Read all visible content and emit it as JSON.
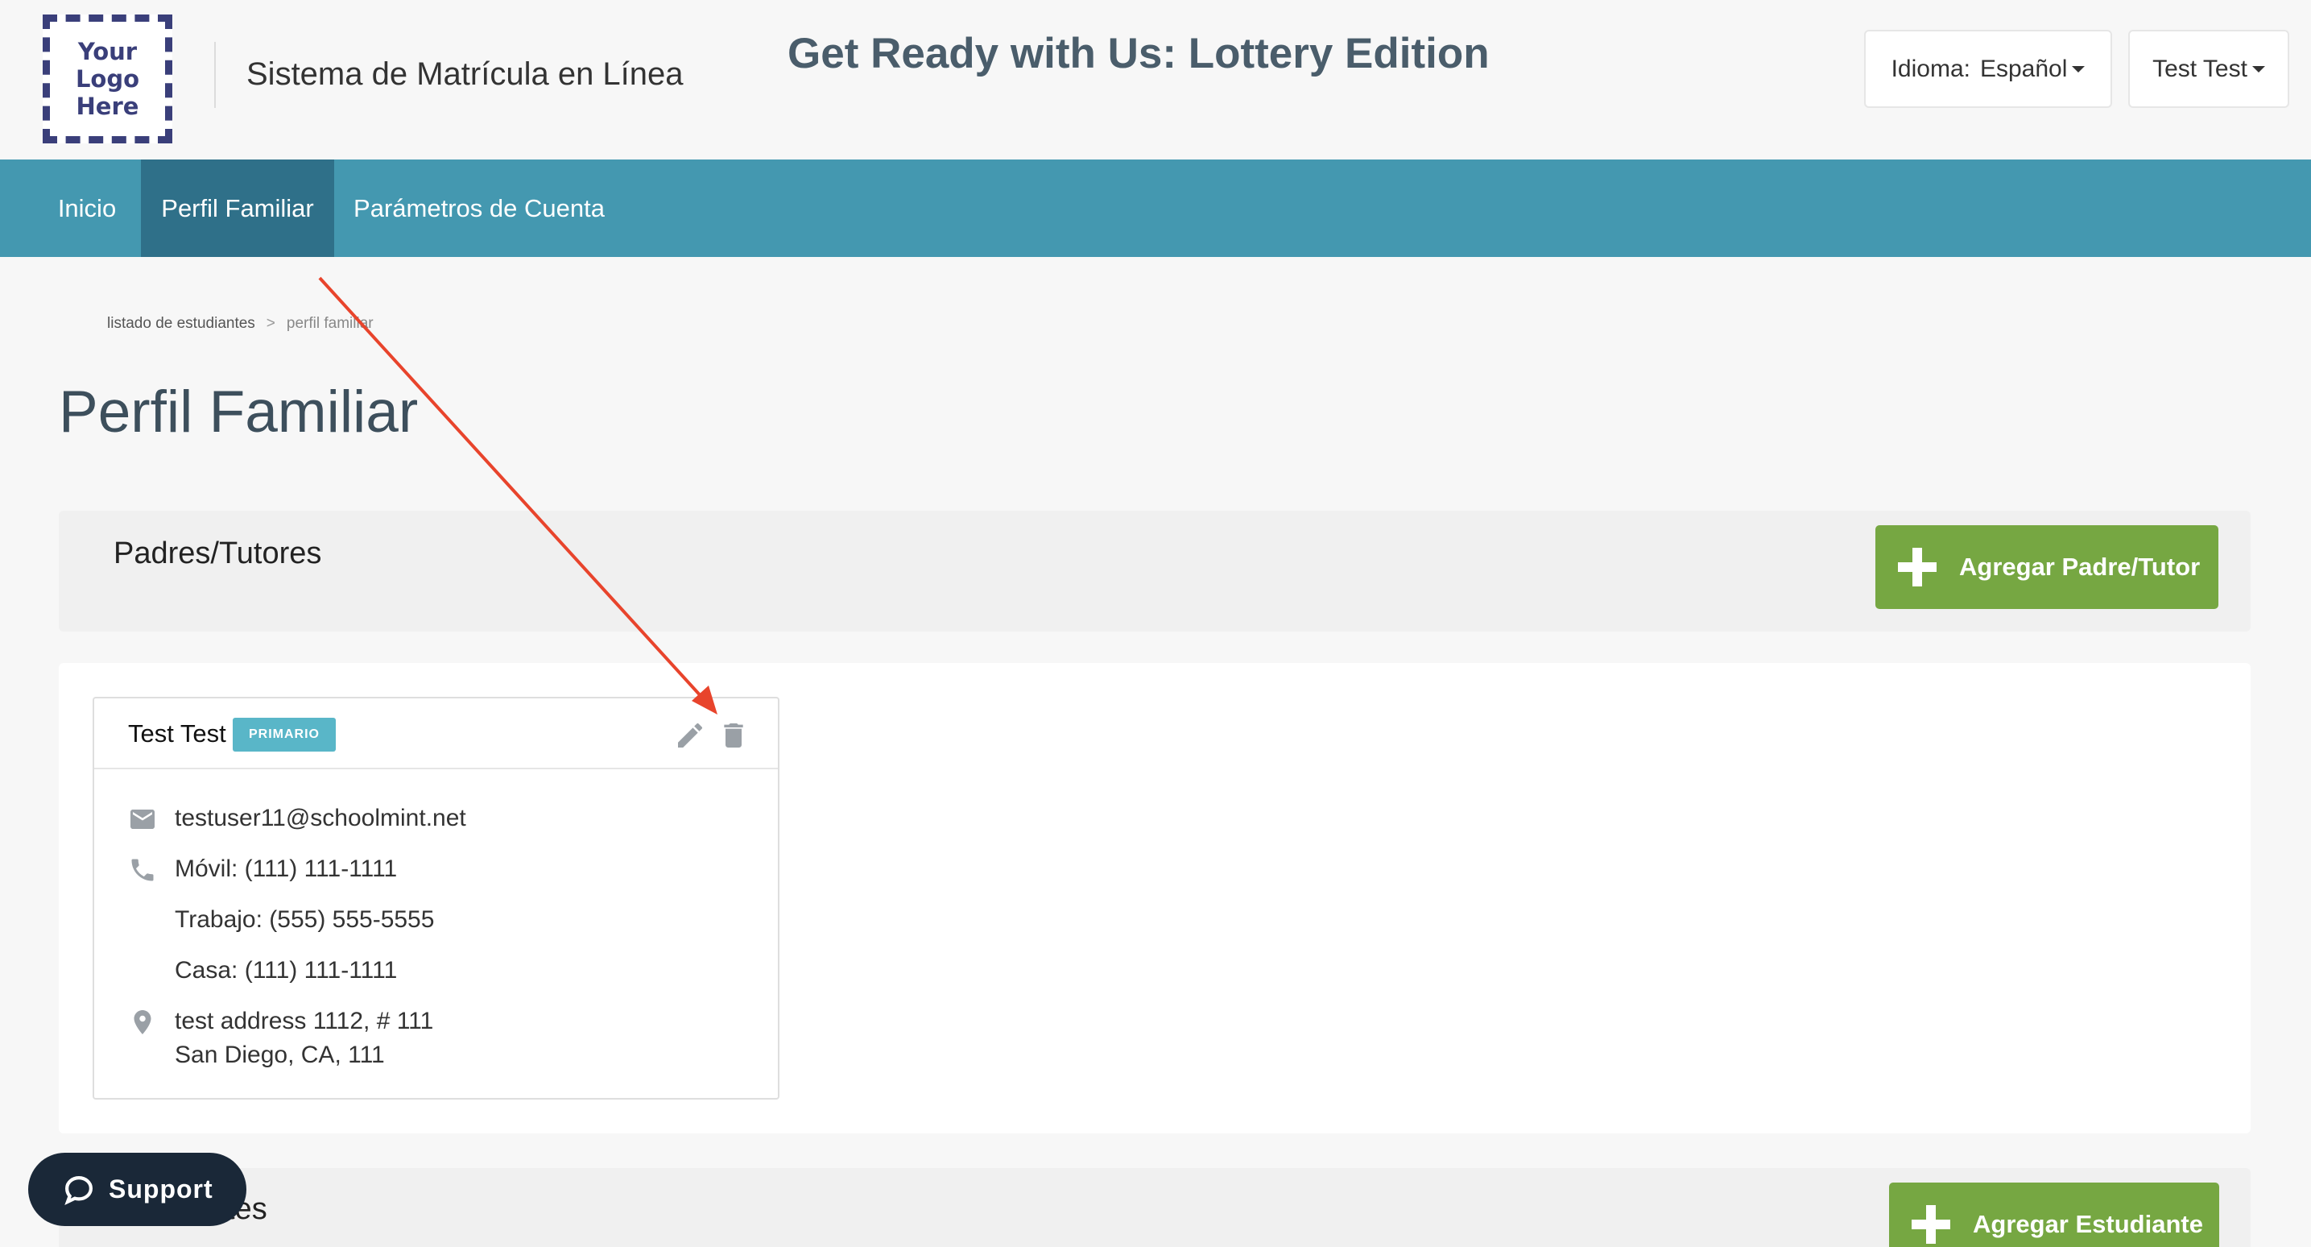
{
  "header": {
    "logo_text": "Your\nLogo\nHere",
    "system_title": "Sistema de Matrícula en Línea",
    "event_title": "Get Ready with Us: Lottery Edition",
    "language_label": "Idioma:",
    "language_value": "Español",
    "user_name": "Test Test"
  },
  "nav": {
    "items": [
      {
        "label": "Inicio",
        "active": false
      },
      {
        "label": "Perfil Familiar",
        "active": true
      },
      {
        "label": "Parámetros de Cuenta",
        "active": false
      }
    ]
  },
  "breadcrumb": {
    "items": [
      "listado de estudiantes",
      "perfil familiar"
    ],
    "separator": ">"
  },
  "page_title": "Perfil Familiar",
  "parents_section": {
    "title": "Padres/Tutores",
    "add_button": "Agregar Padre/Tutor"
  },
  "parent_card": {
    "name": "Test Test",
    "badge": "PRIMARIO",
    "email": "testuser11@schoolmint.net",
    "mobile": "Móvil: (111) 111-1111",
    "work": "Trabajo: (555) 555-5555",
    "home": "Casa: (111) 111-1111",
    "address_line1": "test address 1112, # 111",
    "address_line2": "San Diego, CA, 111"
  },
  "students_section": {
    "title_partial": "tes",
    "add_button": "Agregar Estudiante"
  },
  "support": {
    "label": "Support"
  },
  "colors": {
    "nav_bg": "#4498b0",
    "nav_active": "#2f7089",
    "add_button": "#76a742",
    "badge": "#59b6c8",
    "support_bg": "#1a2838",
    "annotation_arrow": "#e8442c"
  },
  "icons": {
    "edit": "pencil-icon",
    "delete": "trash-icon",
    "email": "envelope-icon",
    "phone": "phone-icon",
    "address": "map-pin-icon",
    "support": "chat-bubble-icon"
  }
}
